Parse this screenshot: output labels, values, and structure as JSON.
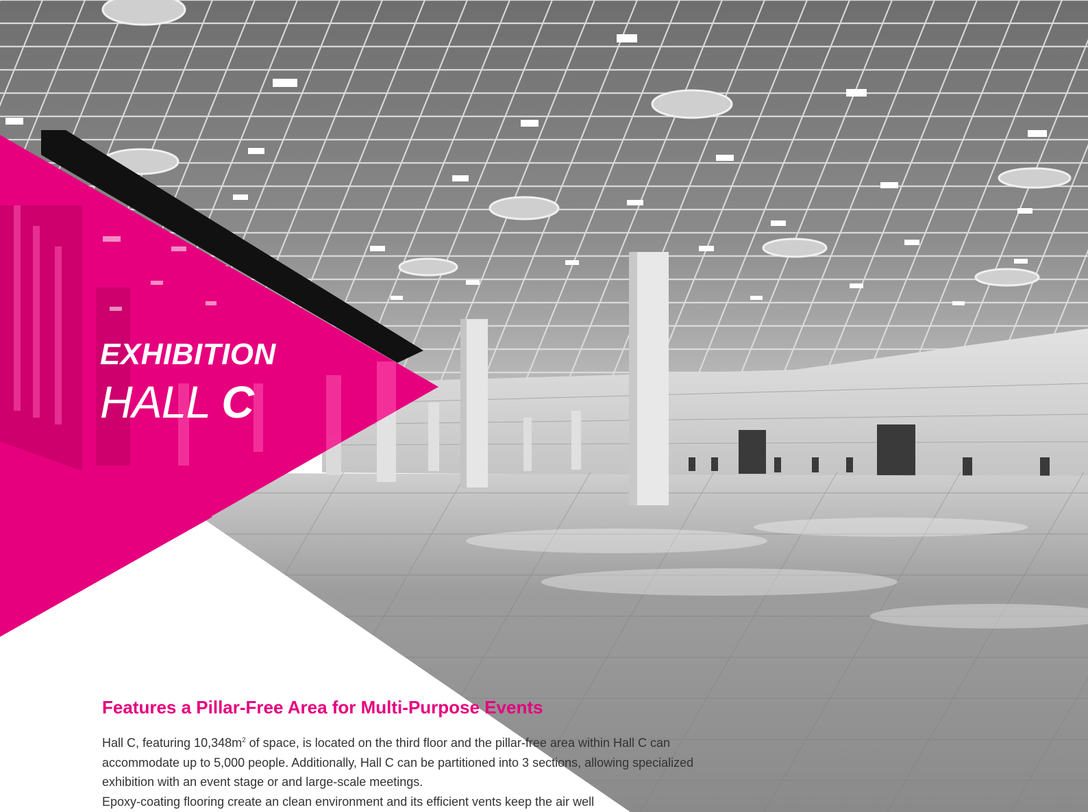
{
  "colors": {
    "accent_magenta": "#e6007e",
    "dark_band": "#111111",
    "text": "#333333"
  },
  "hero": {
    "image": "exhibition-hall-interior-photo",
    "title_line1": "EXHIBITION",
    "title_line2_light": "HALL",
    "title_line2_bold": "C"
  },
  "section": {
    "heading": "Features a Pillar-Free Area for Multi-Purpose Events",
    "para_part1": "Hall C, featuring 10,348m",
    "para_sup": "2",
    "para_part2": " of space, is located on the third floor and the pillar-free area within Hall C can accommodate up to 5,000 people. Additionally, Hall C can be partitioned into 3 sections, allowing specialized exhibition with an event stage or and large-scale meetings.",
    "para_cutoff": "Epoxy-coating flooring create an clean environment and its efficient vents keep the air well"
  }
}
